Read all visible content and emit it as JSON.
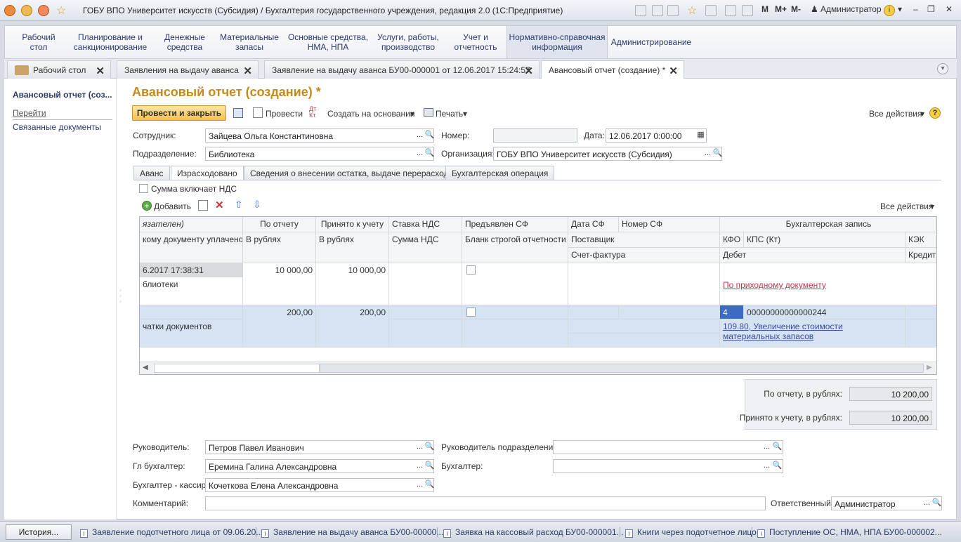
{
  "window": {
    "title": "ГОБУ ВПО Университет искусств (Субсидия) / Бухгалтерия государственного учреждения, редакция 2.0  (1С:Предприятие)",
    "m": "M",
    "mplus": "M+",
    "mminus": "M-",
    "user": "Администратор"
  },
  "sections": [
    "Рабочий\nстол",
    "Планирование и\nсанкционирование",
    "Денежные\nсредства",
    "Материальные\nзапасы",
    "Основные средства,\nНМА, НПА",
    "Услуги, работы,\nпроизводство",
    "Учет и\nотчетность",
    "Нормативно-справочная\nинформация",
    "Администрирование"
  ],
  "tabs": [
    "Рабочий стол",
    "Заявления на выдачу аванса",
    "Заявление на выдачу аванса БУ00-000001 от 12.06.2017 15:24:57",
    "Авансовый отчет (создание) *"
  ],
  "sidebar": {
    "title": "Авансовый отчет (соз...",
    "goto": "Перейти",
    "related": "Связанные документы"
  },
  "doc": {
    "title": "Авансовый отчет (создание) *"
  },
  "toolbar": {
    "post_close": "Провести и закрыть",
    "post": "Провести",
    "create_based": "Создать на основании",
    "print": "Печать",
    "all_actions": "Все действия",
    "help": "?"
  },
  "form": {
    "employee_label": "Сотрудник:",
    "employee": "Зайцева Ольга Константиновна",
    "number_label": "Номер:",
    "number": "",
    "date_label": "Дата:",
    "date": "12.06.2017  0:00:00",
    "division_label": "Подразделение:",
    "division": "Библиотека",
    "org_label": "Организация:",
    "org": "ГОБУ ВПО Университет искусств (Субсидия)"
  },
  "inner_tabs": [
    "Аванс",
    "Израсходовано",
    "Сведения о внесении остатка, выдаче перерасхода",
    "Бухгалтерская операция"
  ],
  "vat_checkbox": "Сумма включает НДС",
  "grid_toolbar": {
    "add": "Добавить",
    "all_actions": "Все действия"
  },
  "grid": {
    "headers": {
      "h1": "язателен)",
      "h2": "По отчету",
      "h3": "Принято к учету",
      "h4": "Ставка НДС",
      "h5": "Предъявлен СФ",
      "h6": "Дата СФ",
      "h7": "Номер СФ",
      "h8": "Бухгалтерская запись",
      "s1": "кому документу уплачено",
      "s2": "В рублях",
      "s3": "В рублях",
      "s4": "Сумма НДС",
      "s5": "Бланк строгой отчетности",
      "s6": "Поставщик",
      "s7": "КФО",
      "s8": "КПС (Кт)",
      "s9": "КЭК",
      "t1": "Счет-фактура",
      "t2": "Дебет",
      "t3": "Кредит"
    },
    "rows": [
      {
        "c1": "6.2017 17:38:31",
        "c1b": "блиотеки",
        "by_report": "10 000,00",
        "accepted": "10 000,00",
        "link": "По приходному документу"
      },
      {
        "c1b": "чатки документов",
        "by_report": "200,00",
        "accepted": "200,00",
        "kfo": "4",
        "kps": "00000000000000244",
        "link": "109.80, Увеличение стоимости материальных запасов"
      }
    ]
  },
  "totals": {
    "by_report_label": "По отчету, в рублях:",
    "by_report": "10 200,00",
    "accepted_label": "Принято к учету, в рублях:",
    "accepted": "10 200,00"
  },
  "bottom": {
    "head_label": "Руководитель:",
    "head": "Петров Павел Иванович",
    "div_head_label": "Руководитель подразделения:",
    "div_head": "",
    "chief_acc_label": "Гл бухгалтер:",
    "chief_acc": "Еремина Галина Александровна",
    "acc_label": "Бухгалтер:",
    "acc": "",
    "cashier_label": "Бухгалтер - кассир:",
    "cashier": "Кочеткова Елена Александровна",
    "comment_label": "Комментарий:",
    "comment": "",
    "resp_label": "Ответственный:",
    "resp": "Администратор"
  },
  "taskbar": {
    "history": "История...",
    "items": [
      "Заявление подотчетного лица от 09.06.20...",
      "Заявление на выдачу аванса БУ00-00000...",
      "Заявка на кассовый расход БУ00-000001...",
      "Книги через подотчетное лицо",
      "Поступление ОС, НМА, НПА БУ00-000002..."
    ]
  }
}
